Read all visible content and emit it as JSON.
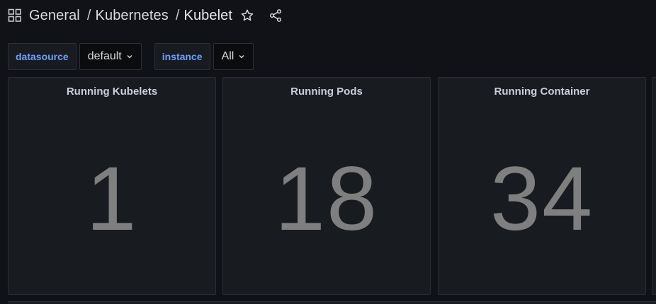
{
  "header": {
    "grid_icon": "dashboard-grid-icon",
    "folder": "General",
    "separator": "/",
    "subfolder": "Kubernetes",
    "title": "Kubelet",
    "star_icon": "star-icon",
    "share_icon": "share-icon"
  },
  "variables": [
    {
      "label": "datasource",
      "value": "default"
    },
    {
      "label": "instance",
      "value": "All"
    }
  ],
  "panels": [
    {
      "title": "Running Kubelets",
      "value": "1"
    },
    {
      "title": "Running Pods",
      "value": "18"
    },
    {
      "title": "Running Container",
      "value": "34"
    }
  ],
  "colors": {
    "background": "#111217",
    "panel": "#181b1f",
    "variable_label": "#6e9fff",
    "stat_value": "#7f7f7f"
  }
}
